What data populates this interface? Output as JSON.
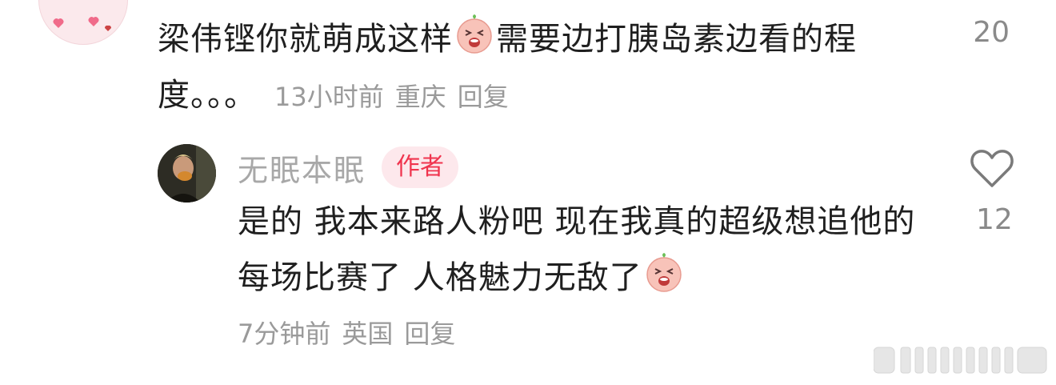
{
  "top_comment": {
    "text_part1": "梁伟铿你就萌成这样",
    "text_part2": "需要边打胰岛素边看的程度。。。",
    "emoji": "crying-peach-emoji",
    "time": "13小时前",
    "location": "重庆",
    "reply_label": "回复",
    "like_count": "20"
  },
  "reply": {
    "username": "无眠本眠",
    "badge": "作者",
    "text": "是的 我本来路人粉吧 现在我真的超级想追他的每场比赛了 人格魅力无敌了",
    "emoji": "crying-peach-emoji",
    "time": "7分钟前",
    "location": "英国",
    "reply_label": "回复",
    "like_count": "12"
  },
  "colors": {
    "text": "#1f1f1f",
    "meta": "#9a9a9a",
    "author_badge_bg": "#fde8ec",
    "author_badge_text": "#f0344e"
  },
  "icons": [
    "heart-outline-icon",
    "crying-peach-emoji"
  ],
  "watermark": "weibo-watermark-logo"
}
